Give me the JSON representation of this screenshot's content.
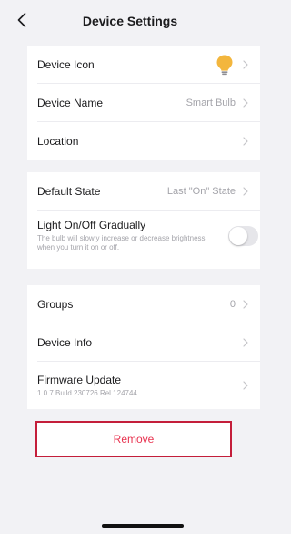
{
  "header": {
    "title": "Device Settings",
    "back_icon": "chevron-left-icon"
  },
  "group1": [
    {
      "label": "Device Icon",
      "value": "",
      "icon": "lightbulb-icon"
    },
    {
      "label": "Device Name",
      "value": "Smart Bulb"
    },
    {
      "label": "Location",
      "value": ""
    }
  ],
  "group2": {
    "default_state": {
      "label": "Default State",
      "value": "Last \"On\" State"
    },
    "gradual": {
      "label": "Light On/Off Gradually",
      "description": "The bulb will slowly increase or decrease brightness when you turn it on or off.",
      "enabled": false
    }
  },
  "group3": {
    "groups": {
      "label": "Groups",
      "value": "0"
    },
    "device_info": {
      "label": "Device Info",
      "value": ""
    },
    "firmware": {
      "label": "Firmware Update",
      "version": "1.0.7 Build 230726 Rel.124744"
    }
  },
  "remove_label": "Remove",
  "colors": {
    "accent_red": "#c41e3a",
    "bulb_yellow": "#f3b63d",
    "background": "#f2f2f5"
  }
}
